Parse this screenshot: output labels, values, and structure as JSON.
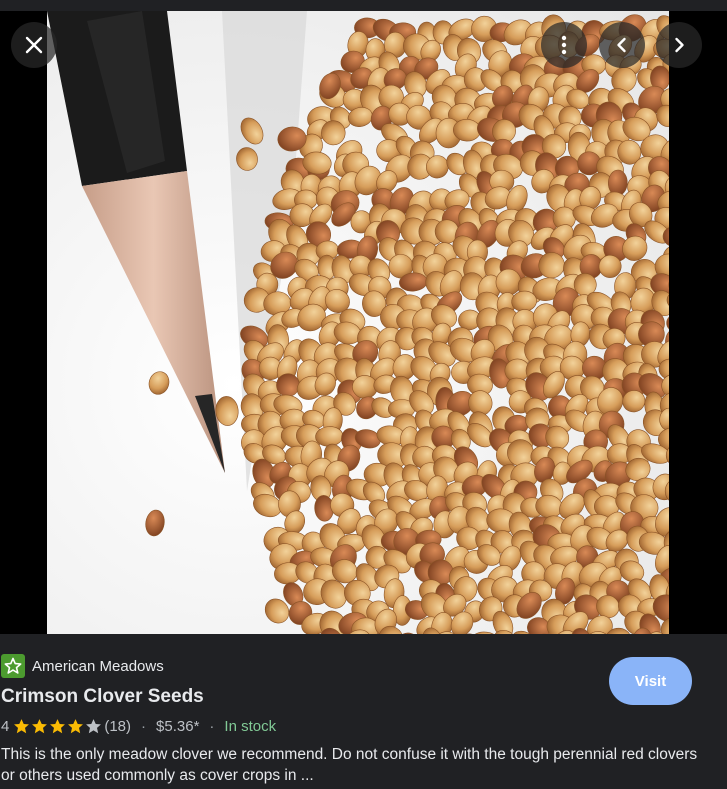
{
  "controls": {
    "close_icon": "close-icon",
    "more_icon": "more-vert-icon",
    "prev_icon": "chevron-left-icon",
    "next_icon": "chevron-right-icon"
  },
  "image": {
    "subject": "product-photo"
  },
  "merchant": {
    "name": "American Meadows",
    "logo_color": "#4c9b2f"
  },
  "product": {
    "title": "Crimson Clover Seeds",
    "rating": "4",
    "rating_value": 4,
    "rating_max": 5,
    "reviews": "(18)",
    "price": "$5.36*",
    "separator": "·",
    "availability": "In stock",
    "description": "This is the only meadow clover we recommend. Do not confuse it with the tough perennial red clovers or others used commonly as cover crops in ..."
  },
  "actions": {
    "visit_label": "Visit",
    "accent": "#8ab4f8"
  }
}
